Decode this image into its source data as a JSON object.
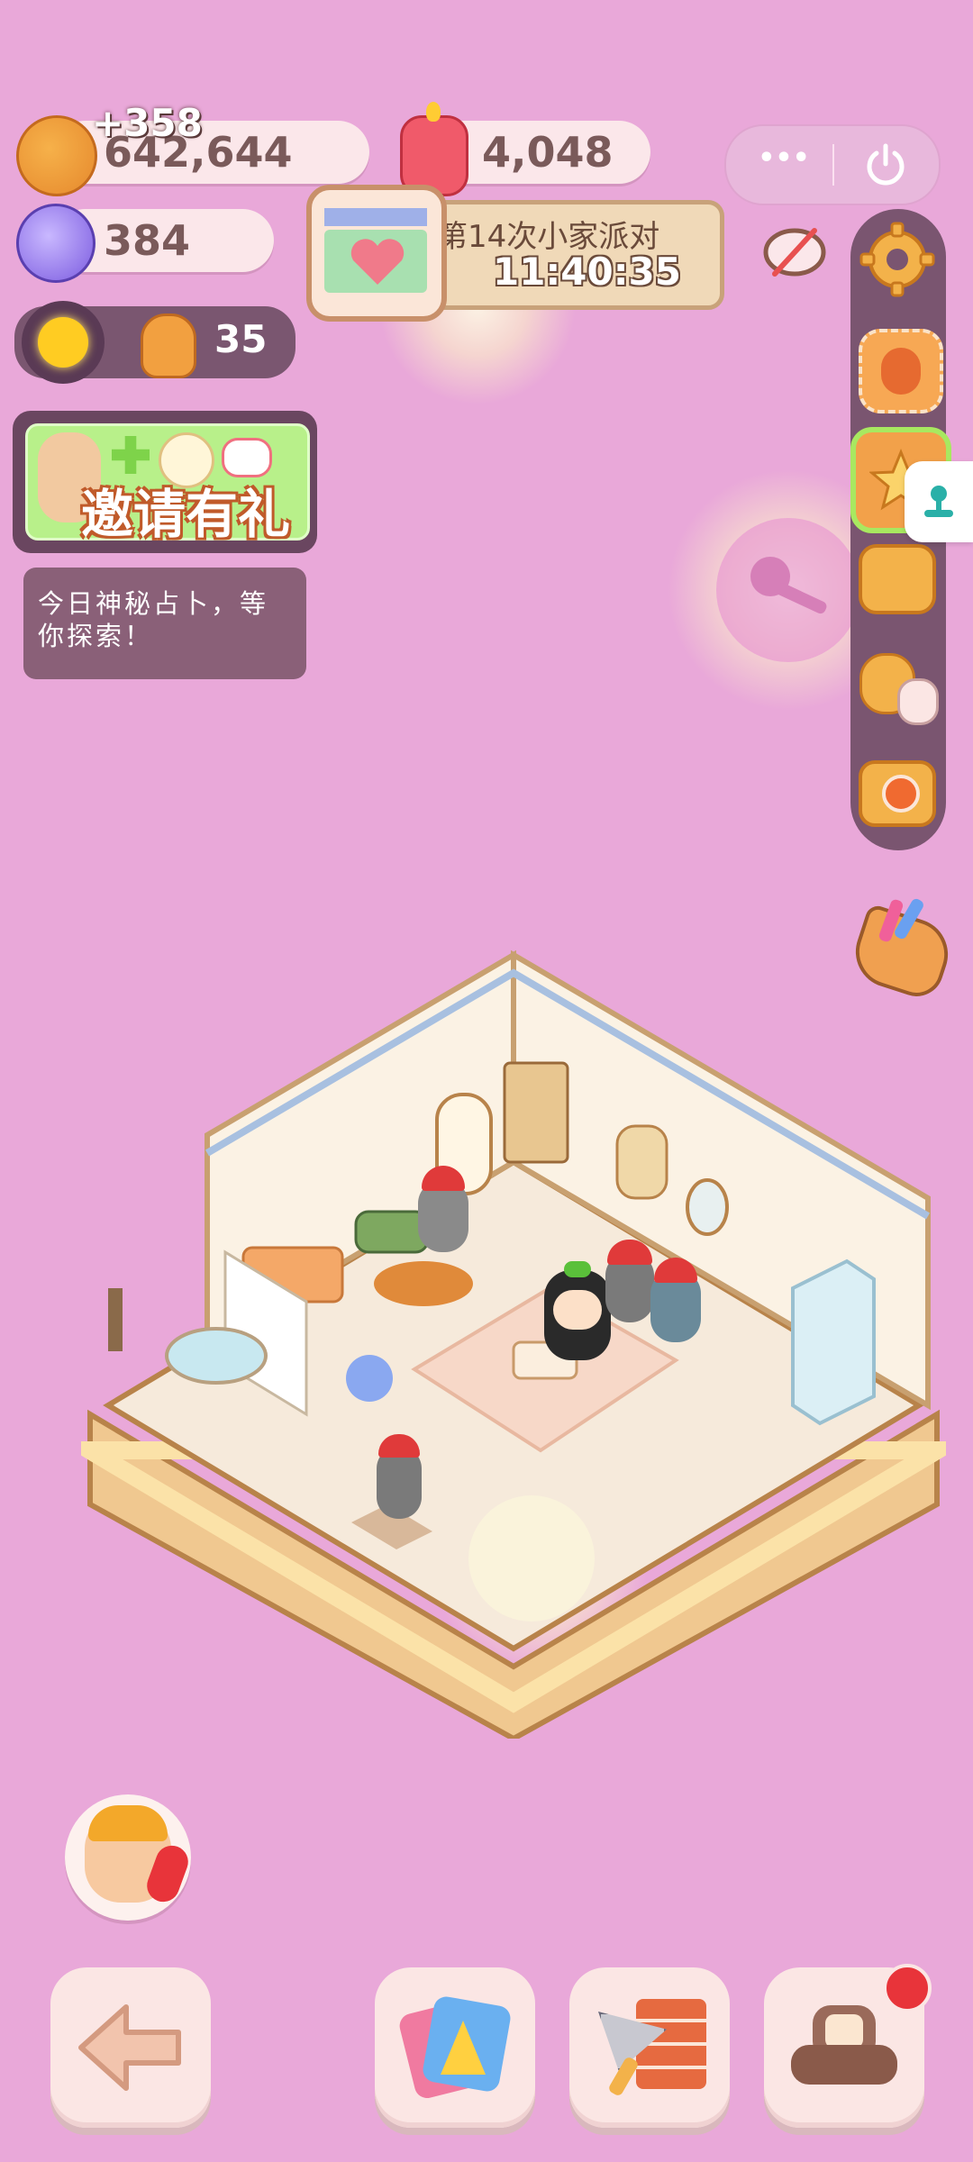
{
  "resources": {
    "cookies": {
      "value": "642,644",
      "gain": "+358",
      "icon": "cookie-icon"
    },
    "candle": {
      "value": "4,048",
      "icon": "candle-icon"
    },
    "candy": {
      "value": "384",
      "icon": "candy-icon"
    },
    "gingerbread": {
      "value": "35",
      "icon": "gingerbread-icon"
    }
  },
  "party": {
    "title": "第14次小家派对",
    "timer": "11:40:35"
  },
  "invite": {
    "label": "邀请有礼"
  },
  "fortune": {
    "text": "今日神秘占卜，等你探索！"
  },
  "miniprogram": {
    "more": "•••",
    "power_icon": "power-icon"
  },
  "side_menu": [
    "gear-icon",
    "stamp-icon",
    "star-shop-icon",
    "backpack-icon",
    "friends-icon",
    "camera-icon"
  ],
  "bottom_bar": [
    "back-arrow-icon",
    "decor-cards-icon",
    "build-trowel-icon",
    "furniture-sofa-icon"
  ],
  "colors": {
    "background": "#e9a8d9",
    "panel": "#7a5570",
    "pill": "#fbe7ea",
    "invite_green": "#b8f08a",
    "notification_red": "#e8343a"
  }
}
